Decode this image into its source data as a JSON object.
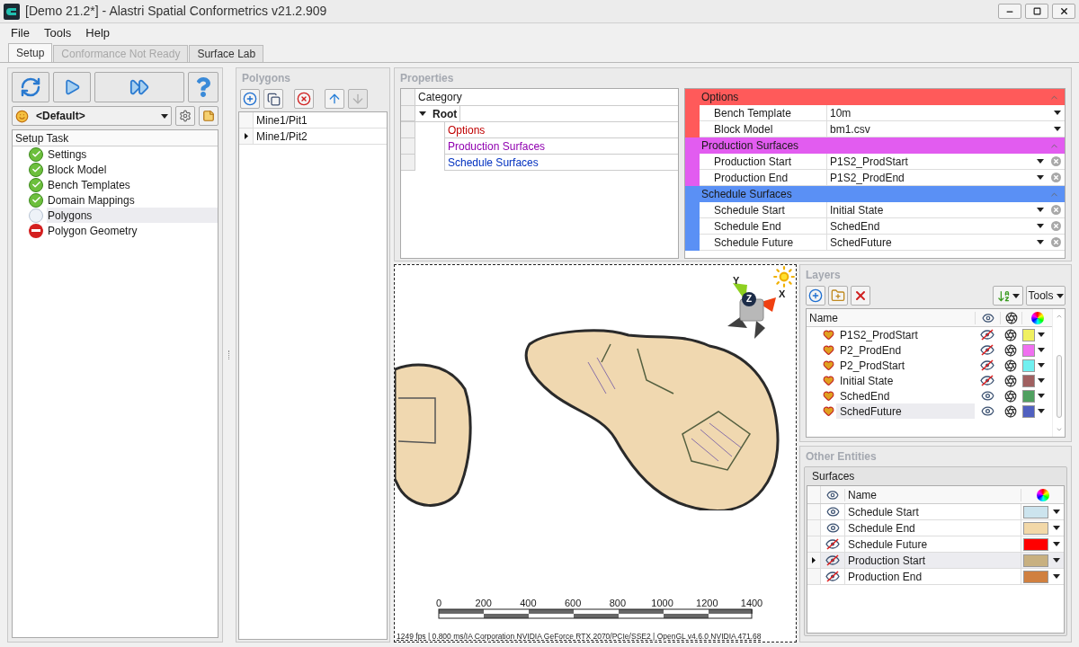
{
  "window": {
    "title": "[Demo 21.2*] - Alastri Spatial Conformetrics v21.2.909"
  },
  "menu": [
    "File",
    "Tools",
    "Help"
  ],
  "tabs": [
    {
      "label": "Setup",
      "selected": true,
      "disabled": false
    },
    {
      "label": "Conformance Not Ready",
      "selected": false,
      "disabled": true
    },
    {
      "label": "Surface Lab",
      "selected": false,
      "disabled": false
    }
  ],
  "setup": {
    "profile": "<Default>",
    "task_header": "Setup Task",
    "tasks": [
      {
        "label": "Settings",
        "kind": "done",
        "selected": false
      },
      {
        "label": "Block Model",
        "kind": "done",
        "selected": false
      },
      {
        "label": "Bench Templates",
        "kind": "done",
        "selected": false
      },
      {
        "label": "Domain Mappings",
        "kind": "done",
        "selected": false
      },
      {
        "label": "Polygons",
        "kind": "pending",
        "selected": true
      },
      {
        "label": "Polygon Geometry",
        "kind": "error",
        "selected": false
      }
    ]
  },
  "polygons": {
    "title": "Polygons",
    "toolbar": [
      {
        "kind": "add",
        "disabled": false
      },
      {
        "kind": "copy",
        "disabled": false
      },
      {
        "kind": "delete",
        "disabled": false
      },
      {
        "kind": "up",
        "disabled": false
      },
      {
        "kind": "down",
        "disabled": true
      }
    ],
    "items": [
      {
        "label": "Mine1/Pit1",
        "selected": false
      },
      {
        "label": "Mine1/Pit2",
        "selected": true
      }
    ]
  },
  "properties": {
    "title": "Properties",
    "category_header": "Category",
    "root": {
      "label": "Root",
      "expanded": true,
      "children": [
        {
          "label": "Options",
          "color": "#c00000"
        },
        {
          "label": "Production Surfaces",
          "color": "#9000b0"
        },
        {
          "label": "Schedule Surfaces",
          "color": "#0030c0"
        }
      ]
    },
    "groups": [
      {
        "title": "Options",
        "color": "#ff5a5a",
        "expanded": true,
        "rows": [
          {
            "label": "Bench Template",
            "value": "10m",
            "clearable": false
          },
          {
            "label": "Block Model",
            "value": "bm1.csv",
            "clearable": false
          }
        ]
      },
      {
        "title": "Production Surfaces",
        "color": "#e25cf0",
        "expanded": true,
        "rows": [
          {
            "label": "Production Start",
            "value": "P1S2_ProdStart",
            "clearable": true
          },
          {
            "label": "Production End",
            "value": "P1S2_ProdEnd",
            "clearable": true
          }
        ]
      },
      {
        "title": "Schedule Surfaces",
        "color": "#5a90f5",
        "expanded": true,
        "rows": [
          {
            "label": "Schedule Start",
            "value": "Initial State",
            "clearable": true
          },
          {
            "label": "Schedule End",
            "value": "SchedEnd",
            "clearable": true
          },
          {
            "label": "Schedule Future",
            "value": "SchedFuture",
            "clearable": true
          }
        ]
      }
    ]
  },
  "viewport": {
    "axes": {
      "y": "Y",
      "z": "Z",
      "x": "X"
    },
    "scale_labels": [
      "0",
      "200",
      "400",
      "600",
      "800",
      "1000",
      "1200",
      "1400"
    ],
    "status": "1249 fps | 0.800 ms/IA Corporation NVIDIA GeForce RTX 2070/PCIe/SSE2 | OpenGL v4.6.0 NVIDIA 471.68"
  },
  "layers": {
    "title": "Layers",
    "tools_label": "Tools",
    "name_header": "Name",
    "items": [
      {
        "name": "P1S2_ProdStart",
        "visible": false,
        "color": "#f0f060",
        "selected": false
      },
      {
        "name": "P2_ProdEnd",
        "visible": false,
        "color": "#f070f0",
        "selected": false
      },
      {
        "name": "P2_ProdStart",
        "visible": false,
        "color": "#70f0f0",
        "selected": false
      },
      {
        "name": "Initial State",
        "visible": false,
        "color": "#a06060",
        "selected": false
      },
      {
        "name": "SchedEnd",
        "visible": true,
        "color": "#50a060",
        "selected": false
      },
      {
        "name": "SchedFuture",
        "visible": true,
        "color": "#5060c0",
        "selected": true
      }
    ]
  },
  "other_entities": {
    "title": "Other Entities",
    "tab": "Surfaces",
    "name_header": "Name",
    "items": [
      {
        "name": "Schedule Start",
        "visible": true,
        "color": "#cce4ee",
        "selected": false
      },
      {
        "name": "Schedule End",
        "visible": true,
        "color": "#f2d8a8",
        "selected": false
      },
      {
        "name": "Schedule Future",
        "visible": false,
        "color": "#ff0000",
        "selected": false
      },
      {
        "name": "Production Start",
        "visible": false,
        "color": "#c8b080",
        "selected": true
      },
      {
        "name": "Production End",
        "visible": false,
        "color": "#d08040",
        "selected": false
      }
    ]
  }
}
